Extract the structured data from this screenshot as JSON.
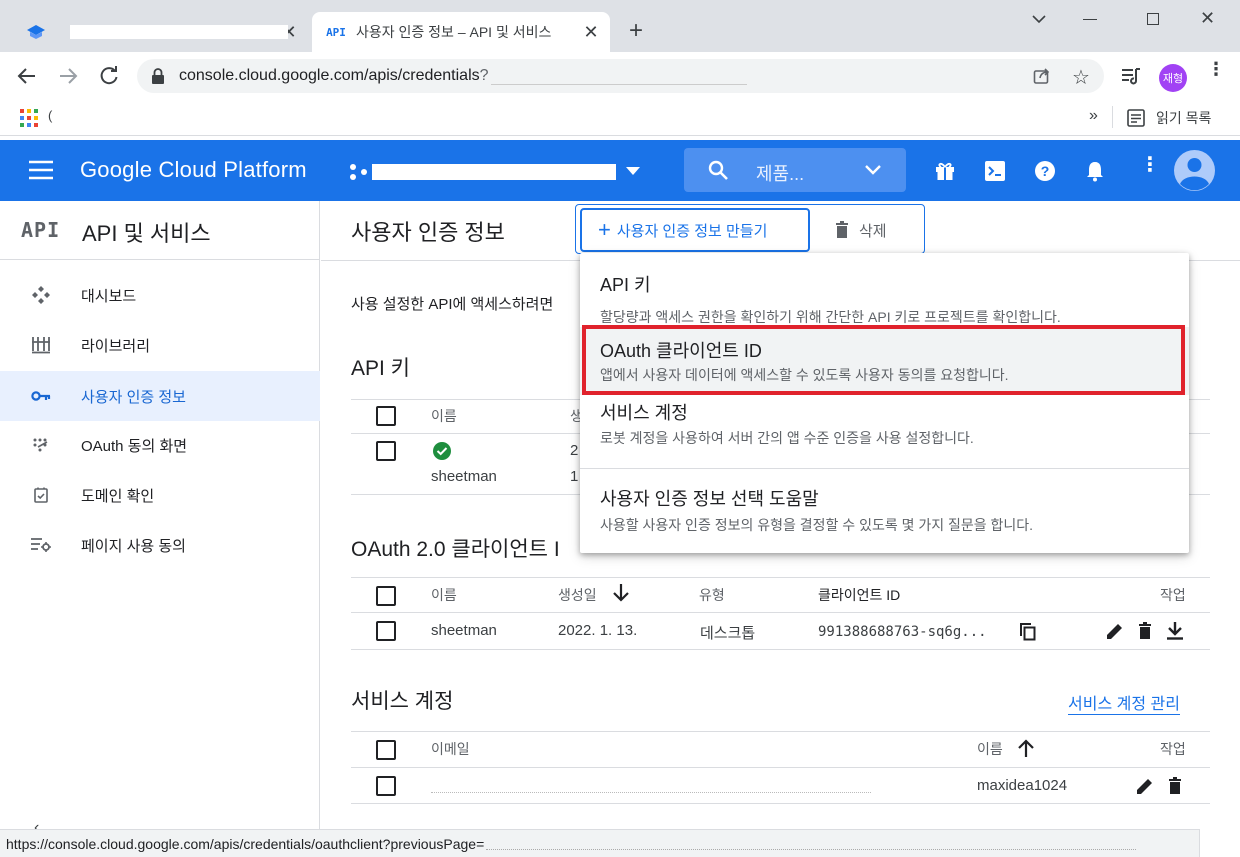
{
  "browser": {
    "tabs": [
      {
        "title": "",
        "active": false
      },
      {
        "title": "사용자 인증 정보 – API 및 서비스",
        "active": true
      }
    ],
    "url": "console.cloud.google.com/apis/credentials",
    "url_tail": "?",
    "profile_label": "재형",
    "bookmark_partial": "(",
    "bookmarks_overflow": "»",
    "reading_list": "읽기 목록",
    "status_url": "https://console.cloud.google.com/apis/credentials/oauthclient?previousPage=",
    "favicon_api": "API",
    "colors": {
      "accent": "#1a73e8",
      "profile": "#a142f4",
      "highlight": "#e0222c"
    }
  },
  "gcp": {
    "product": "Google Cloud Platform",
    "search_placeholder": "제품..."
  },
  "sidebar": {
    "logo": "API",
    "title": "API 및 서비스",
    "items": [
      {
        "label": "대시보드",
        "icon": "dashboard-icon"
      },
      {
        "label": "라이브러리",
        "icon": "library-icon"
      },
      {
        "label": "사용자 인증 정보",
        "icon": "key-icon",
        "active": true
      },
      {
        "label": "OAuth 동의 화면",
        "icon": "consent-icon"
      },
      {
        "label": "도메인 확인",
        "icon": "domain-check-icon"
      },
      {
        "label": "페이지 사용 동의",
        "icon": "page-usage-icon"
      }
    ]
  },
  "main": {
    "title": "사용자 인증 정보",
    "create_label": "사용자 인증 정보 만들기",
    "delete_label": "삭제",
    "hint": "사용 설정한 API에 액세스하려면",
    "api_keys": {
      "title": "API 키",
      "col_name": "이름",
      "col_created_partial": "생",
      "row": {
        "name": "sheetman",
        "created_partial": "2",
        "second_partial": "1"
      }
    },
    "oauth": {
      "title": "OAuth 2.0 클라이언트 I",
      "columns": {
        "name": "이름",
        "created": "생성일",
        "type": "유형",
        "client_id": "클라이언트 ID",
        "actions": "작업"
      },
      "rows": [
        {
          "name": "sheetman",
          "created": "2022. 1. 13.",
          "type": "데스크톱",
          "client_id": "991388688763-sq6g..."
        }
      ]
    },
    "service_accounts": {
      "title": "서비스 계정",
      "manage_link": "서비스 계정 관리",
      "columns": {
        "email": "이메일",
        "name": "이름",
        "actions": "작업"
      },
      "rows": [
        {
          "email": "",
          "name": "maxidea1024"
        }
      ]
    }
  },
  "menu": {
    "items": [
      {
        "title": "API 키",
        "desc": "할당량과 액세스 권한을 확인하기 위해 간단한 API 키로 프로젝트를 확인합니다."
      },
      {
        "title": "OAuth 클라이언트 ID",
        "desc": "앱에서 사용자 데이터에 액세스할 수 있도록 사용자 동의를 요청합니다."
      },
      {
        "title": "서비스 계정",
        "desc": "로봇 계정을 사용하여 서버 간의 앱 수준 인증을 사용 설정합니다."
      },
      {
        "title": "사용자 인증 정보 선택 도움말",
        "desc": "사용할 사용자 인증 정보의 유형을 결정할 수 있도록 몇 가지 질문을 합니다."
      }
    ]
  }
}
